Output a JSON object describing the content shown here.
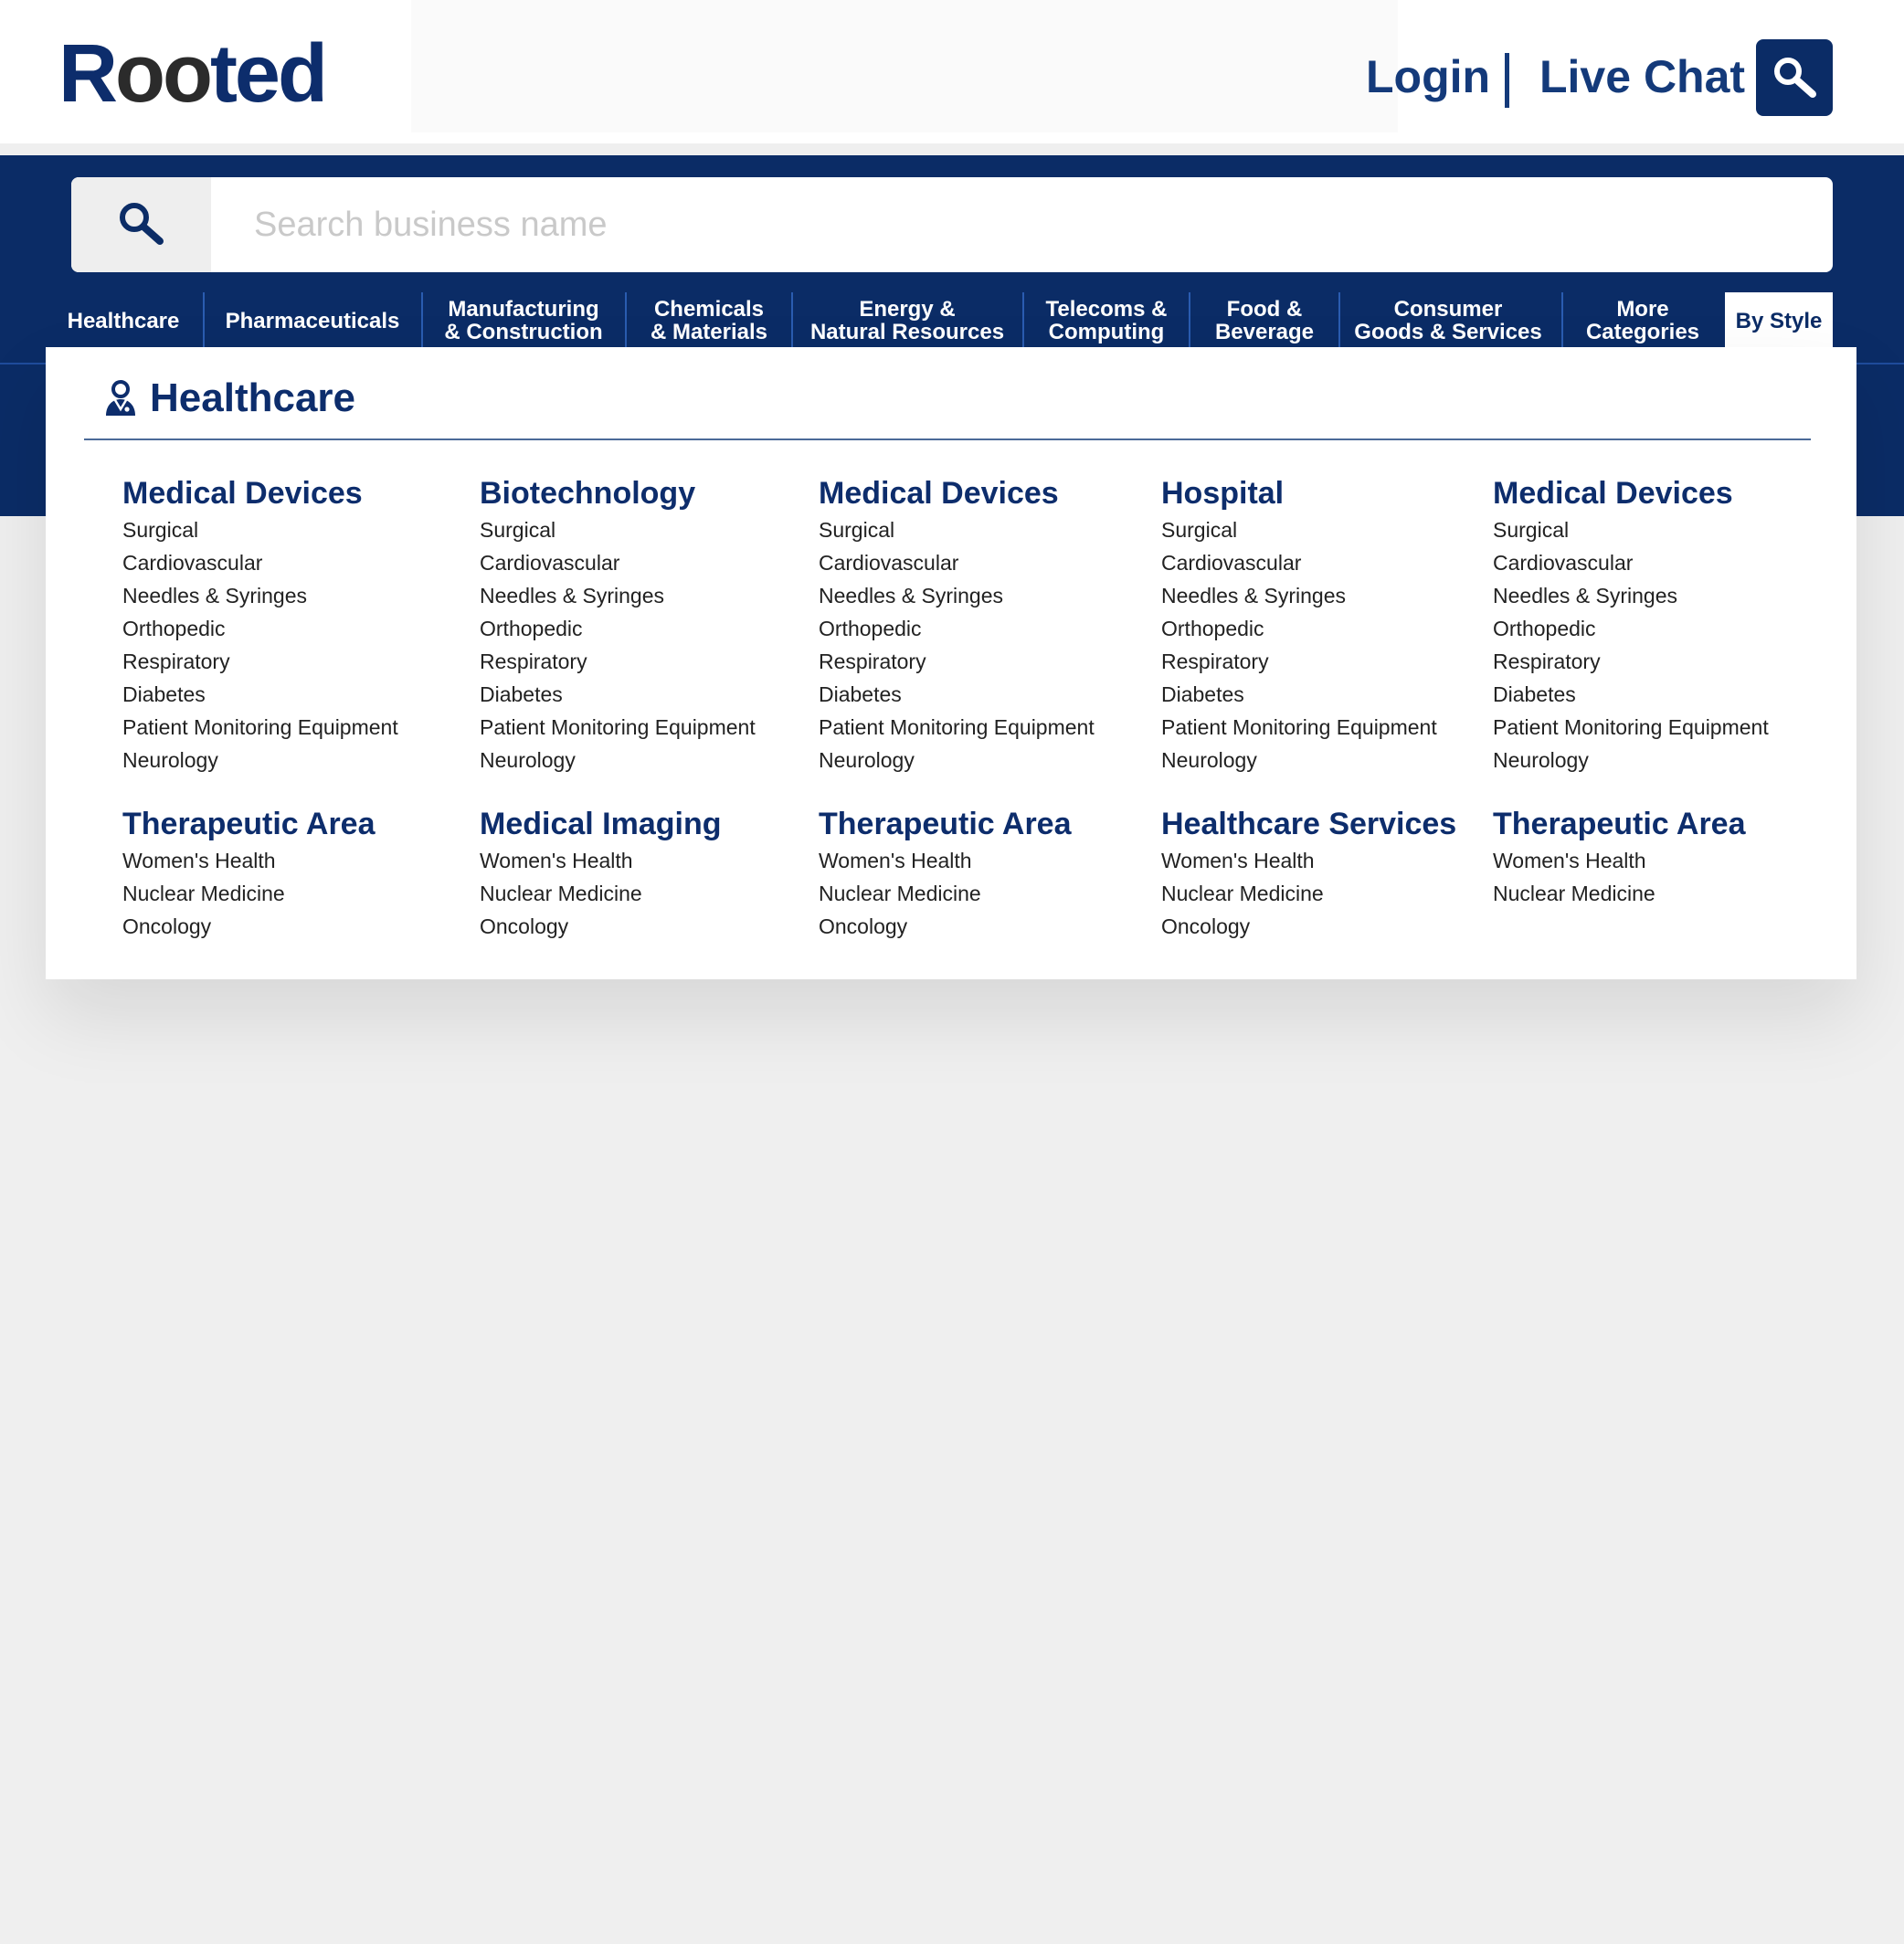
{
  "brand": {
    "logo_r": "R",
    "logo_oo": "oo",
    "logo_ted": "ted"
  },
  "header": {
    "login": "Login",
    "live_chat": "Live Chat"
  },
  "search": {
    "placeholder": "Search business name"
  },
  "nav": [
    {
      "label": "Healthcare"
    },
    {
      "label": "Pharmaceuticals"
    },
    {
      "label": "Manufacturing\n& Construction"
    },
    {
      "label": "Chemicals\n& Materials"
    },
    {
      "label": "Energy &\nNatural Resources"
    },
    {
      "label": "Telecoms &\nComputing"
    },
    {
      "label": "Food &\nBeverage"
    },
    {
      "label": "Consumer\nGoods & Services"
    },
    {
      "label": "More\nCategories"
    },
    {
      "label": "By Style"
    }
  ],
  "panel": {
    "title": "Healthcare",
    "columns": [
      {
        "groups": [
          {
            "title": "Medical Devices",
            "items": [
              "Surgical",
              "Cardiovascular",
              "Needles & Syringes",
              "Orthopedic",
              "Respiratory",
              "Diabetes",
              "Patient Monitoring Equipment",
              "Neurology"
            ]
          },
          {
            "title": "Therapeutic Area",
            "items": [
              "Women's Health",
              "Nuclear Medicine",
              "Oncology"
            ]
          }
        ]
      },
      {
        "groups": [
          {
            "title": "Biotechnology",
            "items": [
              "Surgical",
              "Cardiovascular",
              "Needles & Syringes",
              "Orthopedic",
              "Respiratory",
              "Diabetes",
              "Patient Monitoring Equipment",
              "Neurology"
            ]
          },
          {
            "title": "Medical Imaging",
            "items": [
              "Women's Health",
              "Nuclear Medicine",
              "Oncology"
            ]
          }
        ]
      },
      {
        "groups": [
          {
            "title": "Medical Devices",
            "items": [
              "Surgical",
              "Cardiovascular",
              "Needles & Syringes",
              "Orthopedic",
              "Respiratory",
              "Diabetes",
              "Patient Monitoring Equipment",
              "Neurology"
            ]
          },
          {
            "title": "Therapeutic Area",
            "items": [
              "Women's Health",
              "Nuclear Medicine",
              "Oncology"
            ]
          }
        ]
      },
      {
        "groups": [
          {
            "title": "Hospital",
            "items": [
              "Surgical",
              "Cardiovascular",
              "Needles & Syringes",
              "Orthopedic",
              "Respiratory",
              "Diabetes",
              "Patient Monitoring Equipment",
              "Neurology"
            ]
          },
          {
            "title": "Healthcare Services",
            "items": [
              "Women's Health",
              "Nuclear Medicine",
              "Oncology"
            ]
          }
        ]
      },
      {
        "groups": [
          {
            "title": "Medical Devices",
            "items": [
              "Surgical",
              "Cardiovascular",
              "Needles & Syringes",
              "Orthopedic",
              "Respiratory",
              "Diabetes",
              "Patient Monitoring Equipment",
              "Neurology"
            ]
          },
          {
            "title": "Therapeutic Area",
            "items": [
              "Women's Health",
              "Nuclear Medicine"
            ]
          }
        ]
      }
    ]
  },
  "colors": {
    "brand_navy": "#0b2c66",
    "heading_navy": "#0d2d6c",
    "page_bg": "#efefef"
  },
  "icons": {
    "header_search": "search-icon",
    "search_field": "search-icon",
    "panel_title": "doctor-icon"
  }
}
